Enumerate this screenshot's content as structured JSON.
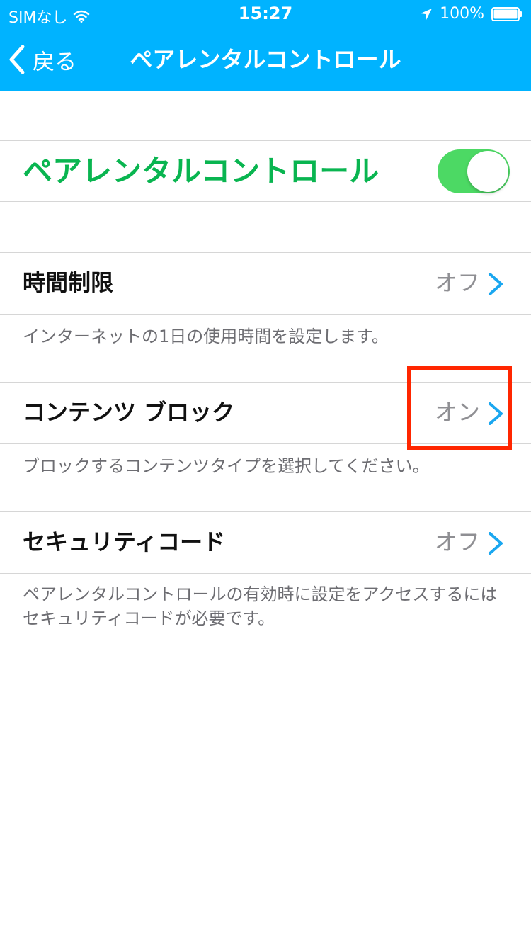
{
  "status_bar": {
    "carrier": "SIMなし",
    "time": "15:27",
    "battery": "100%",
    "wifi_icon": "wifi-icon",
    "location_icon": "location-arrow-icon",
    "battery_icon": "battery-icon"
  },
  "navbar": {
    "back_label": "戻る",
    "back_icon": "chevron-left-icon",
    "title": "ペアレンタルコントロール"
  },
  "master": {
    "title": "ペアレンタルコントロール",
    "enabled": true
  },
  "rows": [
    {
      "title": "時間制限",
      "value": "オフ",
      "description": "インターネットの1日の使用時間を設定します。"
    },
    {
      "title": "コンテンツ ブロック",
      "value": "オン",
      "description": "ブロックするコンテンツタイプを選択してください。"
    },
    {
      "title": "セキュリティコード",
      "value": "オフ",
      "description_line1": "ペアレンタルコントロールの有効時に設定をアクセスするには",
      "description_line2": "セキュリティコードが必要です。"
    }
  ],
  "colors": {
    "nav_blue": "#00b3ff",
    "green_title": "#09b550",
    "toggle_on": "#4cd964",
    "chevron_blue": "#1aa7f0",
    "highlight_red": "#ff2600"
  }
}
